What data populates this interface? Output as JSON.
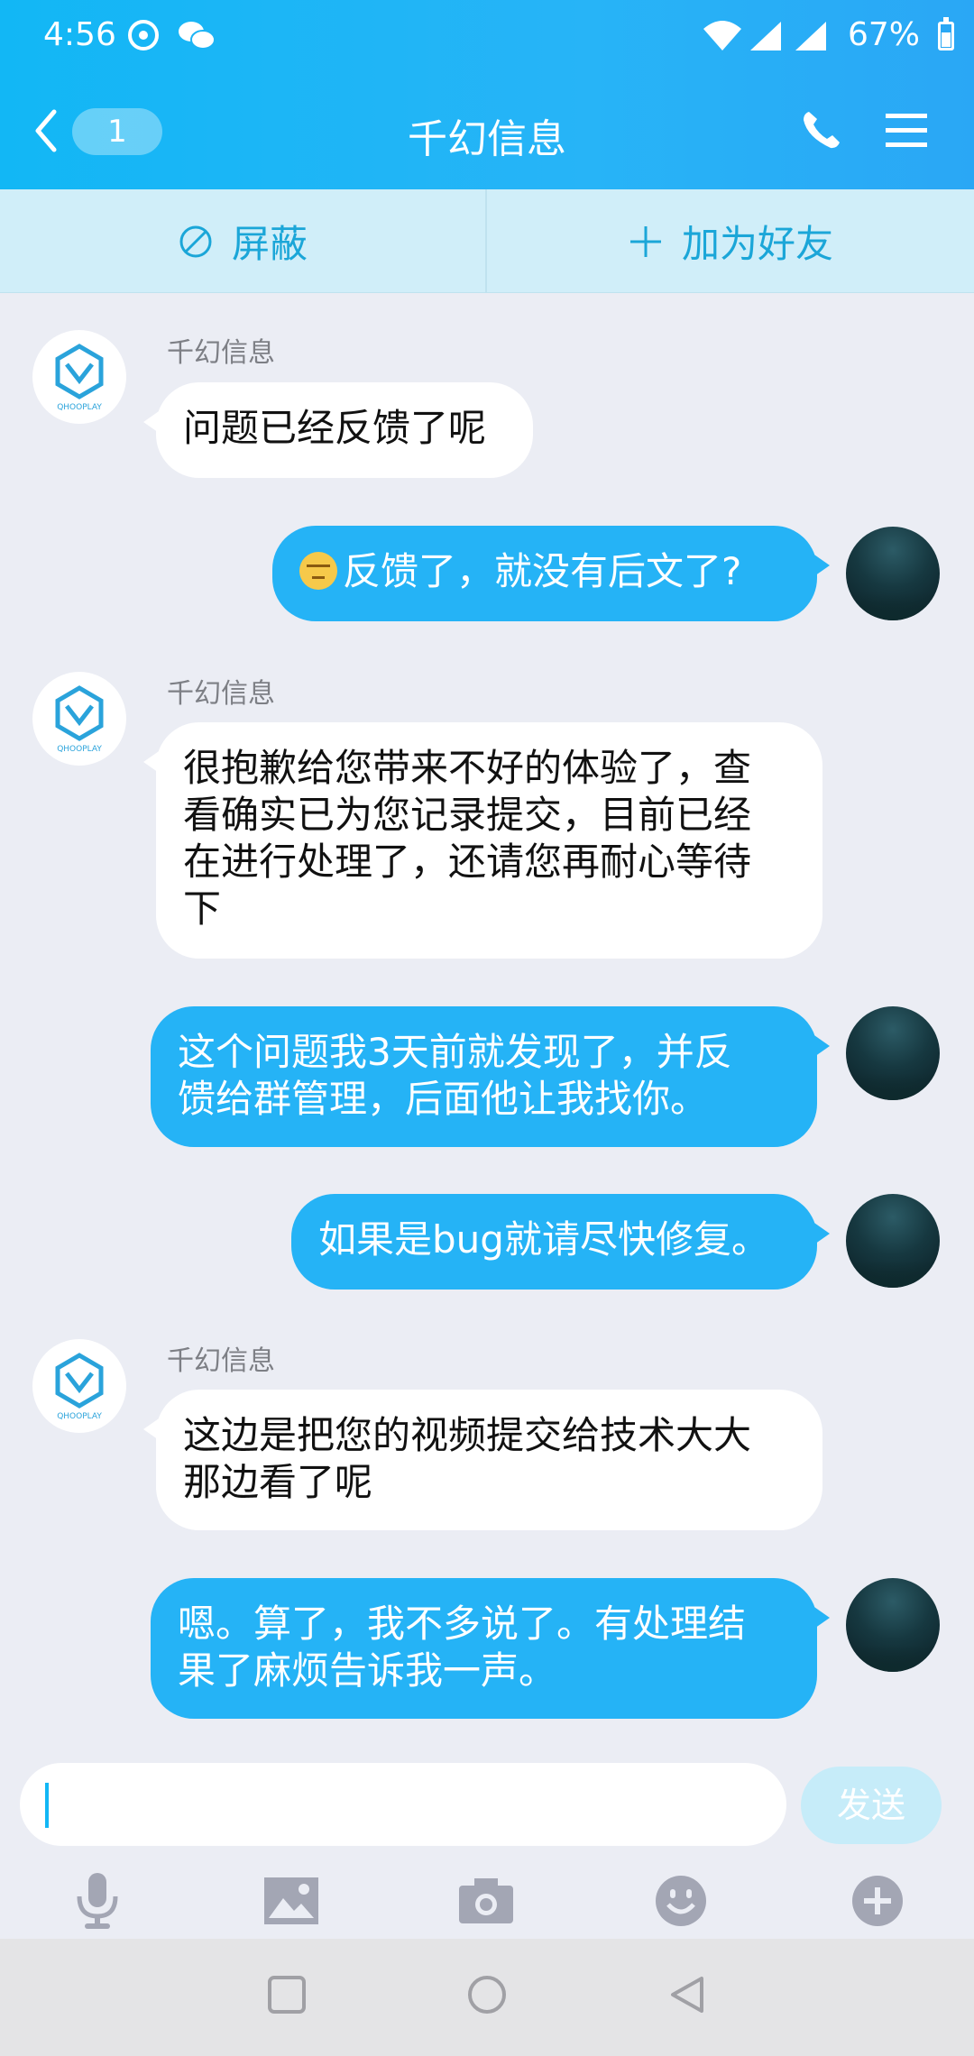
{
  "status_bar": {
    "time": "4:56",
    "battery": "67%"
  },
  "header": {
    "back_badge": "1",
    "title": "千幻信息"
  },
  "actions": {
    "block": "屏蔽",
    "add_friend": "加为好友"
  },
  "messages": [
    {
      "dir": "in",
      "sender": "千幻信息",
      "text": "问题已经反馈了呢"
    },
    {
      "dir": "out",
      "text": "反馈了，就没有后文了?"
    },
    {
      "dir": "in",
      "sender": "千幻信息",
      "lines": [
        "很抱歉给您带来不好的体验了，查",
        "看确实已为您记录提交，目前已经",
        "在进行处理了，还请您再耐心等待",
        "下"
      ]
    },
    {
      "dir": "out",
      "lines": [
        "这个问题我3天前就发现了，并反",
        "馈给群管理，后面他让我找你。"
      ]
    },
    {
      "dir": "out",
      "text": "如果是bug就请尽快修复。"
    },
    {
      "dir": "in",
      "sender": "千幻信息",
      "lines": [
        "这边是把您的视频提交给技术大大",
        "那边看了呢"
      ]
    },
    {
      "dir": "out",
      "lines": [
        "嗯。算了，我不多说了。有处理结",
        "果了麻烦告诉我一声。"
      ]
    }
  ],
  "composer": {
    "send_label": "发送"
  }
}
